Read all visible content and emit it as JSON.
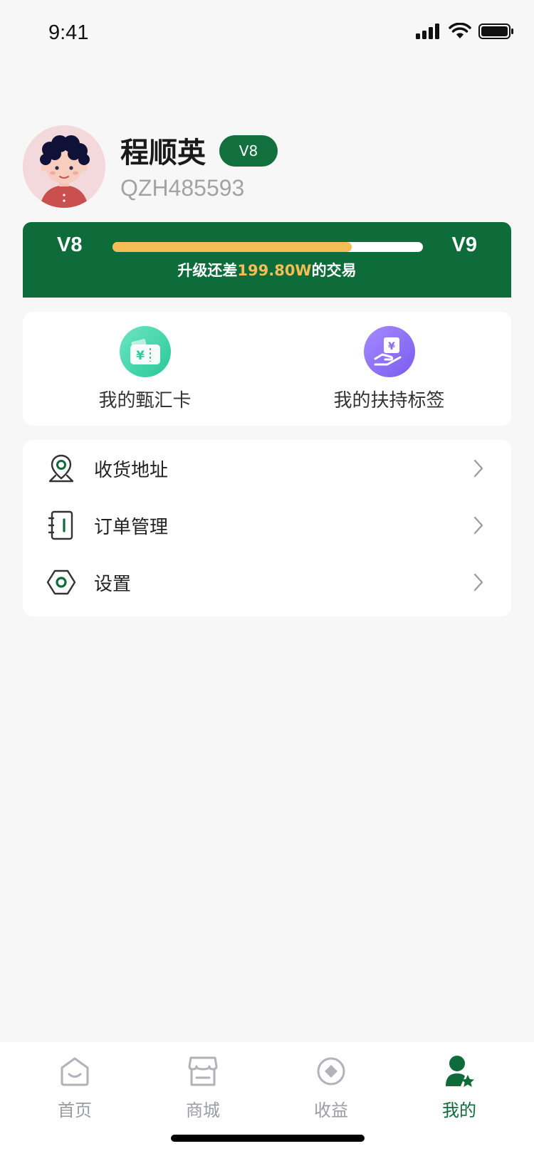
{
  "status_bar": {
    "time": "9:41"
  },
  "profile": {
    "name": "程顺英",
    "badge": "V8",
    "user_id": "QZH485593"
  },
  "level": {
    "current": "V8",
    "next": "V9",
    "progress": 0.77,
    "text_prefix": "升级还差",
    "amount": "199.80W",
    "text_suffix": "的交易",
    "accent_color": "#f5bd55",
    "card_color": "#0e6b3a"
  },
  "cards": [
    {
      "label": "我的甄汇卡",
      "icon": "wallet-card-icon"
    },
    {
      "label": "我的扶持标签",
      "icon": "hand-coin-icon"
    }
  ],
  "menu": [
    {
      "label": "收货地址",
      "icon": "location-pin-icon"
    },
    {
      "label": "订单管理",
      "icon": "notebook-icon"
    },
    {
      "label": "设置",
      "icon": "settings-hexagon-icon"
    }
  ],
  "tabs": [
    {
      "label": "首页",
      "icon": "home-icon",
      "active": false
    },
    {
      "label": "商城",
      "icon": "store-icon",
      "active": false
    },
    {
      "label": "收益",
      "icon": "earnings-icon",
      "active": false
    },
    {
      "label": "我的",
      "icon": "profile-star-icon",
      "active": true
    }
  ]
}
